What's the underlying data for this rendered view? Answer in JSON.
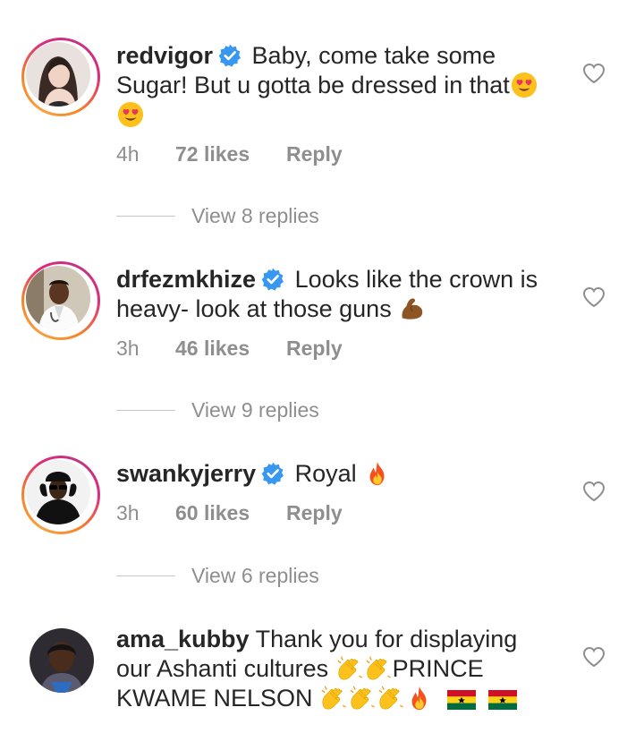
{
  "icons": {
    "verified": "verified-badge-icon",
    "like": "heart-outline-icon",
    "heart_eyes": "heart-eyes-emoji",
    "flexed_biceps": "flexed-biceps-emoji",
    "fire": "fire-emoji",
    "clapping_hands": "clapping-hands-emoji",
    "ghana_flag": "ghana-flag-emoji"
  },
  "colors": {
    "text": "#262626",
    "secondary": "#8e8e8e",
    "verified": "#3897f0",
    "story_ring_start": "#f58529",
    "story_ring_end": "#dd2a7b"
  },
  "comments": [
    {
      "username": "redvigor",
      "verified": true,
      "text_lines": [
        "Baby, come take some",
        "Sugar! But u gotta be dressed in that"
      ],
      "time": "4h",
      "likes": "72 likes",
      "reply": "Reply",
      "view_replies": "View 8 replies"
    },
    {
      "username": "drfezmkhize",
      "verified": true,
      "text_lines": [
        "Looks like the crown is",
        "heavy- look at those guns"
      ],
      "time": "3h",
      "likes": "46 likes",
      "reply": "Reply",
      "view_replies": "View 9 replies"
    },
    {
      "username": "swankyjerry",
      "verified": true,
      "text_lines": [
        "Royal"
      ],
      "time": "3h",
      "likes": "60 likes",
      "reply": "Reply",
      "view_replies": "View 6 replies"
    },
    {
      "username": "ama_kubby",
      "verified": false,
      "text_lines": [
        "Thank you for displaying",
        "our Ashanti cultures",
        "PRINCE",
        "KWAME NELSON"
      ]
    }
  ]
}
